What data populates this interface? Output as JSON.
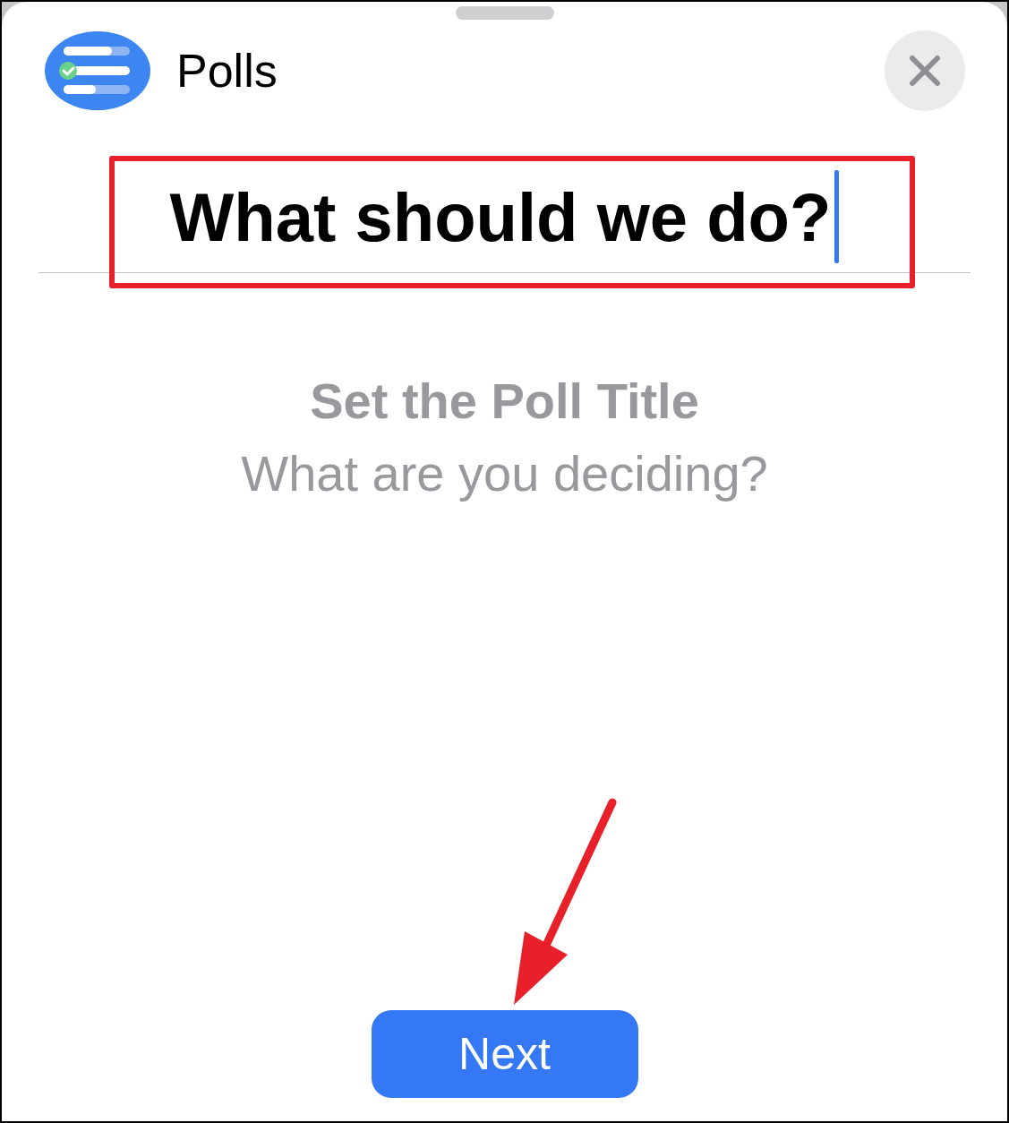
{
  "app": {
    "name": "Polls"
  },
  "title_field": {
    "value": "What should we do?",
    "focused": true
  },
  "prompt": {
    "heading": "Set the Poll Title",
    "subtitle": "What are you deciding?"
  },
  "next_button": {
    "label": "Next"
  }
}
